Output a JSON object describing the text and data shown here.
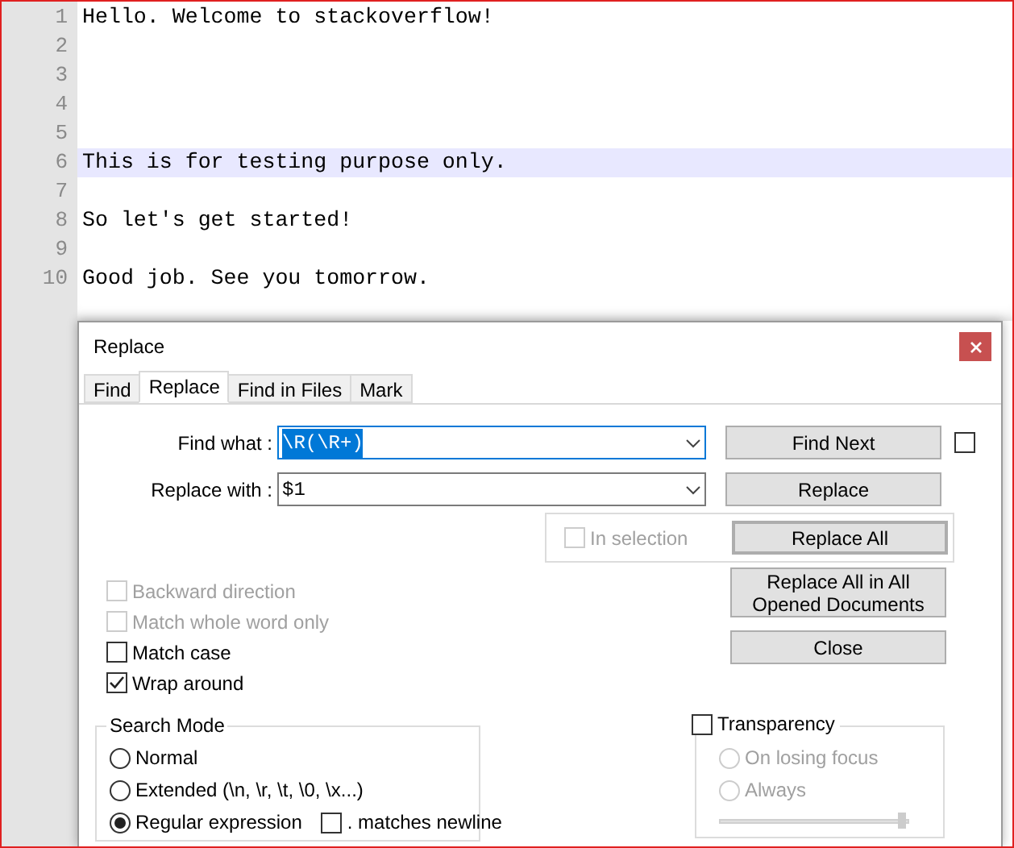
{
  "editor": {
    "lines": [
      {
        "number": "1",
        "text": "Hello. Welcome to stackoverflow!",
        "current": false
      },
      {
        "number": "2",
        "current": false
      },
      {
        "number": "3",
        "current": false
      },
      {
        "number": "4",
        "current": false
      },
      {
        "number": "5",
        "current": false
      },
      {
        "number": "6",
        "text": "This is for testing purpose only.",
        "current": true
      },
      {
        "number": "7",
        "current": false
      },
      {
        "number": "8",
        "text": "So let's get started!",
        "current": false
      },
      {
        "number": "9",
        "current": false
      },
      {
        "number": "10",
        "text": "Good job. See you tomorrow.",
        "current": false
      }
    ]
  },
  "dialog": {
    "title": "Replace",
    "tabs": [
      {
        "label": "Find",
        "selected": false
      },
      {
        "label": "Replace",
        "selected": true
      },
      {
        "label": "Find in Files",
        "selected": false
      },
      {
        "label": "Mark",
        "selected": false
      }
    ],
    "fields": [
      {
        "label": "Find what :",
        "value": "\\R(\\R+)",
        "text_selected": true,
        "button": "Find Next"
      },
      {
        "label": "Replace with :",
        "value": "$1",
        "text_selected": false,
        "button": "Replace"
      }
    ],
    "side_checkbox": {
      "checked": false
    },
    "in_selection": {
      "label": "In selection",
      "checked": false,
      "disabled": true
    },
    "replace_all": "Replace All",
    "options": [
      {
        "label": "Backward direction",
        "checked": false,
        "disabled": true
      },
      {
        "label": "Match whole word only",
        "checked": false,
        "disabled": true
      },
      {
        "label": "Match case",
        "checked": false,
        "disabled": false
      },
      {
        "label": "Wrap around",
        "checked": true,
        "disabled": false
      }
    ],
    "buttons": [
      "Replace All in All Opened Documents",
      "Close"
    ],
    "search_mode": {
      "title": "Search Mode",
      "options": [
        {
          "label": "Normal",
          "selected": false
        },
        {
          "label": "Extended (\\n, \\r, \\t, \\0, \\x...)",
          "selected": false
        },
        {
          "label": "Regular expression",
          "selected": true
        }
      ],
      "newline": {
        "label": ". matches newline",
        "checked": false
      }
    },
    "transparency": {
      "label": "Transparency",
      "checked": false,
      "options": [
        {
          "label": "On losing focus",
          "selected": false,
          "disabled": true
        },
        {
          "label": "Always",
          "selected": false,
          "disabled": true
        }
      ],
      "level": 0.97
    }
  }
}
